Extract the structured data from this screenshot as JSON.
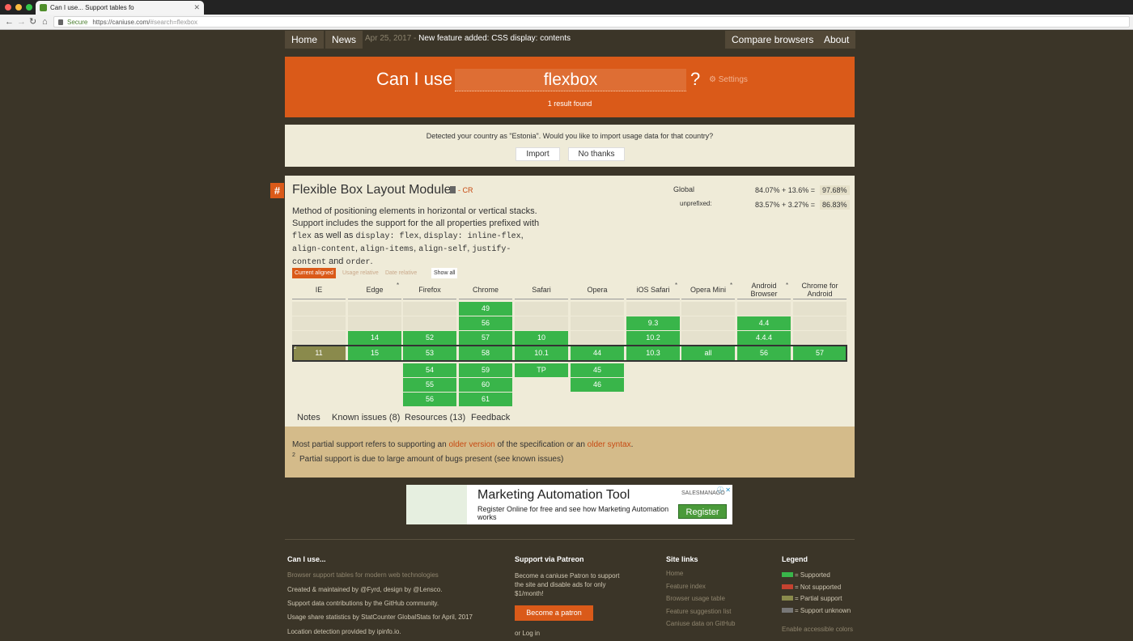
{
  "browser": {
    "tab_title": "Can I use... Support tables fo",
    "secure_label": "Secure",
    "url_host": "https://caniuse.com/",
    "url_path": "#search=flexbox"
  },
  "nav": {
    "home": "Home",
    "news": "News",
    "news_date": "Apr 25, 2017",
    "news_sep": " - ",
    "news_text": "New feature added: CSS display: contents",
    "compare": "Compare browsers",
    "about": "About"
  },
  "search": {
    "prefix": "Can I use",
    "value": "flexbox",
    "suffix": "?",
    "settings": "Settings",
    "result_count": "1 result found"
  },
  "country": {
    "message": "Detected your country as \"Estonia\". Would you like to import usage data for that country?",
    "import": "Import",
    "no_thanks": "No thanks"
  },
  "feature": {
    "hash": "#",
    "title": "Flexible Box Layout Module",
    "status": "- CR",
    "desc_1": "Method of positioning elements in horizontal or vertical stacks. Support includes the support for the all properties prefixed with ",
    "code_flex": "flex",
    "desc_2": " as well as ",
    "code_1": "display: flex",
    "code_2": "display: inline-flex",
    "code_3": "align-content",
    "code_4": "align-items",
    "code_5": "align-self",
    "code_6": "justify-content",
    "desc_and": " and ",
    "code_7": "order",
    "comma": ", ",
    "period": ".",
    "global_label": "Global",
    "global_vals": "84.07% + 13.6% =",
    "global_total": "97.68%",
    "unprefixed_label": "unprefixed:",
    "unprefixed_vals": "83.57% + 3.27% =",
    "unprefixed_total": "86.83%"
  },
  "view_buttons": {
    "current": "Current aligned",
    "usage": "Usage relative",
    "date": "Date relative",
    "show_all": "Show all"
  },
  "browsers": [
    {
      "name": "IE",
      "star": false
    },
    {
      "name": "Edge",
      "star": true
    },
    {
      "name": "Firefox",
      "star": false
    },
    {
      "name": "Chrome",
      "star": false
    },
    {
      "name": "Safari",
      "star": false
    },
    {
      "name": "Opera",
      "star": false
    },
    {
      "name": "iOS Safari",
      "star": true
    },
    {
      "name": "Opera Mini",
      "star": true
    },
    {
      "name": "Android Browser",
      "star": true
    },
    {
      "name": "Chrome for Android",
      "star": false
    }
  ],
  "star_symbol": "*",
  "support_rows": [
    [
      "",
      "",
      "",
      "49",
      "",
      "",
      "",
      "",
      "",
      ""
    ],
    [
      "",
      "",
      "",
      "56",
      "",
      "",
      "9.3",
      "",
      "4.4",
      ""
    ],
    [
      "",
      "14",
      "52",
      "57",
      "10",
      "",
      "10.2",
      "",
      "4.4.4",
      ""
    ],
    [
      "11",
      "15",
      "53",
      "58",
      "10.1",
      "44",
      "10.3",
      "all",
      "56",
      "57"
    ],
    [
      "",
      "",
      "54",
      "59",
      "TP",
      "45",
      "",
      "",
      "",
      ""
    ],
    [
      "",
      "",
      "55",
      "60",
      "",
      "46",
      "",
      "",
      "",
      ""
    ],
    [
      "",
      "",
      "56",
      "61",
      "",
      "",
      "",
      "",
      "",
      ""
    ]
  ],
  "ie_note_marker": "2",
  "tabs": {
    "notes": "Notes",
    "known_issues": "Known issues (8)",
    "resources": "Resources (13)",
    "feedback": "Feedback"
  },
  "notes": {
    "p1_a": "Most partial support refers to supporting an ",
    "p1_link1": "older version",
    "p1_b": " of the specification or an ",
    "p1_link2": "older syntax",
    "p1_c": ".",
    "sup": "2",
    "p2": "Partial support is due to large amount of bugs present (see known issues)"
  },
  "ad": {
    "title": "Marketing Automation Tool",
    "text": "Register Online for free and see how Marketing Automation works",
    "button": "Register",
    "logo": "SALESMANAGO",
    "close": "ⓘ ✕"
  },
  "footer": {
    "caniuse_head": "Can I use...",
    "caniuse_tagline": "Browser support tables for modern web technologies",
    "created": "Created & maintained by @Fyrd, design by @Lensco.",
    "contrib": "Support data contributions by the GitHub community.",
    "usage": "Usage share statistics by StatCounter GlobalStats for April, 2017",
    "location": "Location detection provided by ipinfo.io.",
    "patreon_head": "Support via Patreon",
    "patreon_text": "Become a caniuse Patron to support the site and disable ads for only $1/month!",
    "patreon_btn": "Become a patron",
    "or_login": "or Log in",
    "sitelinks_head": "Site links",
    "sitelinks": [
      "Home",
      "Feature index",
      "Browser usage table",
      "Feature suggestion list",
      "Caniuse data on GitHub"
    ],
    "legend_head": "Legend",
    "legend": [
      "= Supported",
      "= Not supported",
      "= Partial support",
      "= Support unknown"
    ],
    "legend_colors": [
      "#39b54a",
      "#c44230",
      "#8a8a4c",
      "#777777"
    ],
    "accessible": "Enable accessible colors"
  }
}
